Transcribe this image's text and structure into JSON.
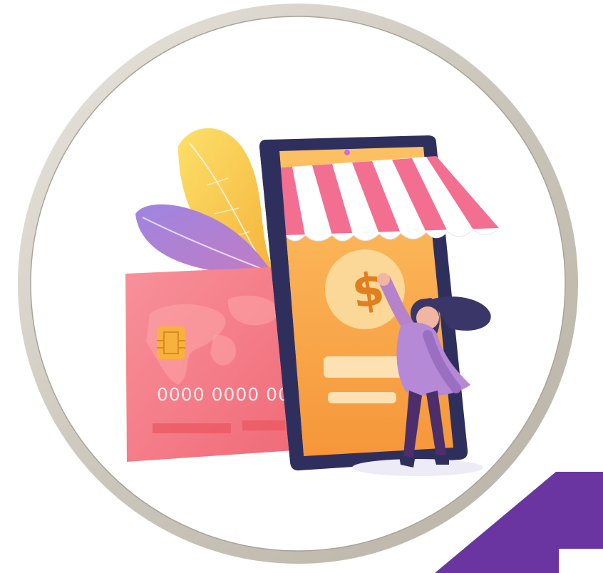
{
  "illustration": {
    "card_number_text": "0000 0000 0000",
    "currency_symbol": "$",
    "icons": [
      "credit-card-icon",
      "smartphone-shop-icon",
      "awning-icon",
      "dollar-coin-icon",
      "person-figure"
    ]
  },
  "colors": {
    "frame_ring": "#cfcbc2",
    "background": "#ffffff",
    "card": "#f47e86",
    "phone_frame": "#2f2f5e",
    "phone_screen": "#f6a84a",
    "awning_stripe": "#f26f92",
    "coin": "#fbd898",
    "leaf_yellow": "#f7c947",
    "leaf_purple": "#a889d8",
    "corner_accent": "#6a35a0"
  }
}
